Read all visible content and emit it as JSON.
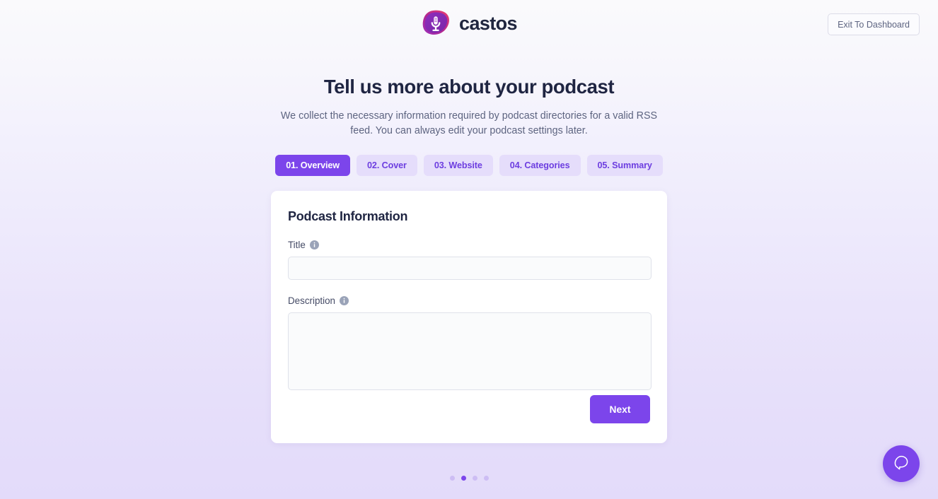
{
  "header": {
    "brand_name": "castos",
    "brand_icon": "microphone-logo-icon",
    "exit_label": "Exit To Dashboard"
  },
  "intro": {
    "title": "Tell us more about your podcast",
    "subtitle": "We collect the necessary information required by podcast directories for a valid RSS feed. You can always edit your podcast settings later."
  },
  "steps": [
    {
      "label": "01. Overview",
      "active": true
    },
    {
      "label": "02. Cover",
      "active": false
    },
    {
      "label": "03. Website",
      "active": false
    },
    {
      "label": "04. Categories",
      "active": false
    },
    {
      "label": "05. Summary",
      "active": false
    }
  ],
  "card": {
    "title": "Podcast Information",
    "fields": {
      "title": {
        "label": "Title",
        "value": "",
        "placeholder": "",
        "info_icon": "info-circle-icon"
      },
      "description": {
        "label": "Description",
        "value": "",
        "placeholder": "",
        "info_icon": "info-circle-icon"
      }
    },
    "next_label": "Next"
  },
  "pagination": {
    "dots": 4,
    "active_index": 1
  },
  "beacon": {
    "icon": "chat-bubble-icon"
  },
  "colors": {
    "accent": "#7c45eb",
    "accent_soft": "#e5ddfb",
    "heading": "#1f2542",
    "body_text": "#5d6480",
    "card_bg": "#ffffff",
    "input_bg": "#fafbfc",
    "input_border": "#dfe2ea",
    "page_bg_top": "#fafafc",
    "page_bg_bottom": "#e3dbfa",
    "logo_pink": "#e8346f",
    "logo_purple": "#7a2bb5"
  }
}
